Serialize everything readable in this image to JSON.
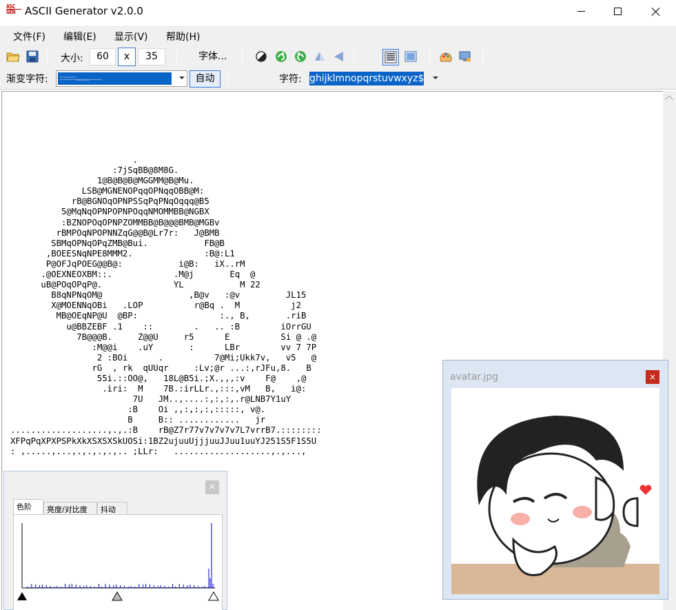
{
  "window": {
    "title": "ASCII Generator v2.0.0",
    "icon_lines": [
      "ASC",
      "GEN"
    ]
  },
  "menu": [
    "文件(F)",
    "编辑(E)",
    "显示(V)",
    "帮助(H)"
  ],
  "toolbar": {
    "size_label": "大小:",
    "width_value": "60",
    "x_label": "x",
    "height_value": "35",
    "font_button": "字体..."
  },
  "toolbar2": {
    "ramp_label": "渐变字符:",
    "ramp_value": "::::::::::::,,,,,,,,,,..........",
    "auto_button": "自动",
    "chars_label": "字符:",
    "chars_value": "ghijklmnopqrstuvwxyz$"
  },
  "ascii_art": [
    "                        .",
    "                    :7jSqBB@8M8G.",
    "                 1@B@B@B@MGGMM@B@Mu.",
    "              LSB@MGNENOPqqOPNqqOBB@M:",
    "            rB@BGNOqOPNPSSqPqPNqOqqq@B5",
    "          5@MqNqOPNPOPNPOqqNMOMMBB@NGBX",
    "          :BZNOPOqOPNPZOMMBB@B@@@BMB@MGBv",
    "         rBMPOqNPOPNNZqG@@B@Lr7r:   J@BMB",
    "        SBMqOPNqOPqZMB@Bui.           FB@B",
    "       ,BOEESNqNPE8MMM2.              :B@:L1",
    "       P@OFJqPOEG@@B@:           i@B:   iX..rM",
    "      .@OEXNEOXBM::.            .M@j       Eq  @",
    "      uB@POqOPqP@.              YL           M 22",
    "        B8qNPNqOM@                 ,B@v   :@v         JL15",
    "        X@MOENNqOBi   .LOP          r@Bq .  M          j2",
    "         MB@OEqNP@U  @BP:                :., B,       .riB",
    "           u@BBZEBF .1    ::        .   .. :B        iOrrGU",
    "             7B@@@B.     Z@@U     r5      E          Si @ .@",
    "                :M@@i    .uY       :      LBr        vv 7 7P",
    "                 2 :BOi      .          7@Mi;Ukk7v,   v5   @",
    "                rG  , rk  qUUqr     :Lv;@r ...:,rJFu,8.   B",
    "                 55i.::OO@,   18L@B5i.;X.,,,:v    F@    ,@",
    "                  .iri:  M    7B.:irLLr.,:::,vM   B,   i@:",
    "                        7U   JM..,....:,:,:,.r@LNB7Y1uY",
    "                       :B    Oi ,,:,:,:,:::::, v@.",
    "                       B     B:: ............   jr",
    "...................,.,.:B    rB@Z7r77v7v7v7v7L7vrrB7.::::::::",
    "XFPqPqXPXPSPkXkXSXSXSkUOSi:1BZ2ujuuUjjjuuJJuu1uuYJ251S5F1S5U",
    ": ,.....,...,.,.,.,.,.. ;LLr:   ...................,.,...,"
  ],
  "histogram_panel": {
    "tabs": [
      "色阶",
      "亮度/对比度",
      "抖动"
    ],
    "close_label": "×"
  },
  "avatar_window": {
    "title": "avatar.jpg",
    "close_label": "×"
  },
  "colors": {
    "selection": "#0a64c8",
    "accent_border": "#3a7bd5",
    "histogram_bar": "#0000cc",
    "close_red": "#c42b1c"
  }
}
